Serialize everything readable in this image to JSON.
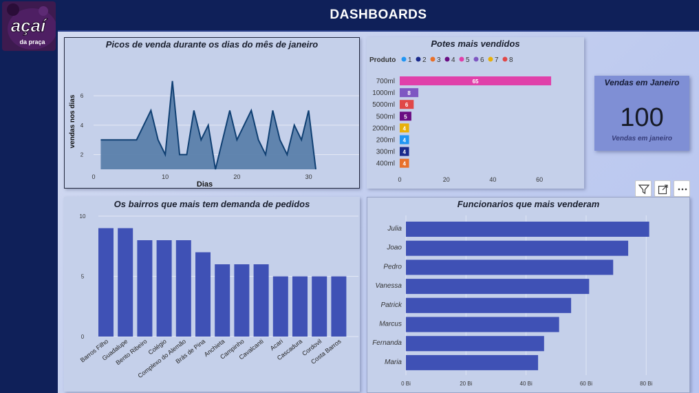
{
  "header": {
    "title": "DASHBOARDS"
  },
  "logo": {
    "text": "açaí",
    "subtext": "da praça"
  },
  "kpi": {
    "title": "Vendas em Janeiro",
    "value": "100",
    "label": "Vendas em janeiro"
  },
  "toolbar": {
    "icons": [
      "filter-icon",
      "focus-mode-icon",
      "more-options-icon"
    ]
  },
  "chart_data": [
    {
      "type": "area",
      "title": "Picos de venda durante os dias do mês de janeiro",
      "xlabel": "Dias",
      "ylabel": "vendas nos dias",
      "xlim": [
        0,
        31
      ],
      "ylim": [
        1,
        7.5
      ],
      "x_ticks": [
        0,
        10,
        20,
        30
      ],
      "y_ticks": [
        2,
        4,
        6
      ],
      "x": [
        1,
        2,
        3,
        4,
        5,
        6,
        7,
        8,
        9,
        10,
        11,
        12,
        13,
        14,
        15,
        16,
        17,
        18,
        19,
        20,
        21,
        22,
        23,
        24,
        25,
        26,
        27,
        28,
        29,
        30,
        31
      ],
      "values": [
        3,
        3,
        3,
        3,
        3,
        3,
        4,
        5,
        3,
        2,
        7,
        2,
        2,
        5,
        3,
        4,
        1,
        3,
        5,
        3,
        4,
        5,
        3,
        2,
        5,
        3,
        2,
        4,
        3,
        5,
        1
      ],
      "color": "#5b7fab",
      "line_color": "#0f3f72"
    },
    {
      "type": "bar",
      "orientation": "horizontal",
      "title": "Potes mais vendidos",
      "legend_title": "Produto",
      "legend_placement": "top",
      "legend": [
        {
          "name": "1",
          "color": "#2196f3"
        },
        {
          "name": "2",
          "color": "#1a2a8c"
        },
        {
          "name": "3",
          "color": "#e8702a"
        },
        {
          "name": "4",
          "color": "#6a0d83"
        },
        {
          "name": "5",
          "color": "#e040aa"
        },
        {
          "name": "6",
          "color": "#7e57c2"
        },
        {
          "name": "7",
          "color": "#e8b00a"
        },
        {
          "name": "8",
          "color": "#e04848"
        }
      ],
      "categories": [
        "700ml",
        "1000ml",
        "5000ml",
        "500ml",
        "2000ml",
        "200ml",
        "300ml",
        "400ml"
      ],
      "values": [
        65,
        8,
        6,
        5,
        4,
        4,
        4,
        4
      ],
      "colors": [
        "#e040aa",
        "#7e57c2",
        "#e04848",
        "#6a0d83",
        "#e8b00a",
        "#2196f3",
        "#1a2a8c",
        "#e8702a"
      ],
      "xlim": [
        0,
        70
      ],
      "x_ticks": [
        0,
        20,
        40,
        60
      ]
    },
    {
      "type": "bar",
      "title": "Os bairros que mais tem demanda de pedidos",
      "categories": [
        "Barros Filho",
        "Guadalupe",
        "Bento Ribeiro",
        "Colégio",
        "Complexo do Alemão",
        "Brás de Pina",
        "Anchieta",
        "Campinho",
        "Cavalcanti",
        "Acari",
        "Cascadura",
        "Cordovil",
        "Costa Barros"
      ],
      "values": [
        9,
        9,
        8,
        8,
        8,
        7,
        6,
        6,
        6,
        5,
        5,
        5,
        5
      ],
      "ylim": [
        0,
        10
      ],
      "y_ticks": [
        0,
        5,
        10
      ],
      "color": "#3f51b5"
    },
    {
      "type": "bar",
      "orientation": "horizontal",
      "title": "Funcionarios que mais venderam",
      "categories": [
        "Julia",
        "Joao",
        "Pedro",
        "Vanessa",
        "Patrick",
        "Marcus",
        "Fernanda",
        "Maria"
      ],
      "values": [
        81,
        74,
        69,
        61,
        55,
        51,
        46,
        44
      ],
      "unit": "Bi",
      "xlim": [
        0,
        82
      ],
      "x_ticks": [
        "0 Bi",
        "20 Bi",
        "40 Bi",
        "60 Bi",
        "80 Bi"
      ],
      "color": "#3f51b5"
    }
  ]
}
